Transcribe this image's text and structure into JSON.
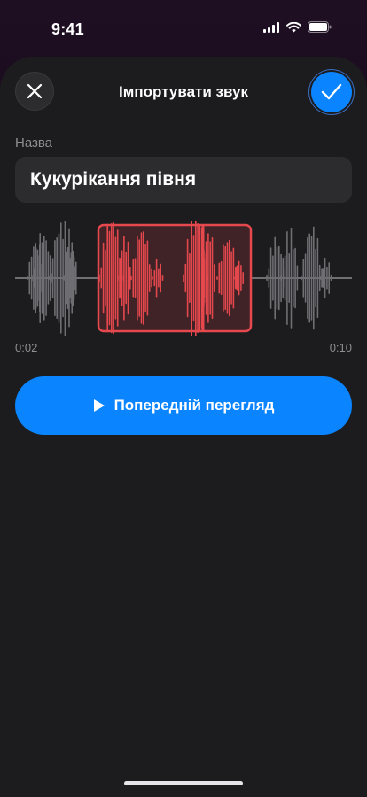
{
  "status_bar": {
    "time": "9:41",
    "icons": [
      "cellular-signal-icon",
      "wifi-icon",
      "battery-icon"
    ]
  },
  "sheet": {
    "title": "Імпортувати звук",
    "close_icon": "close-icon",
    "confirm_icon": "checkmark-icon"
  },
  "name_field": {
    "label": "Назва",
    "value": "Кукурікання півня"
  },
  "trimmer": {
    "start_time": "0:02",
    "end_time": "0:10",
    "selection_start_fraction": 0.23,
    "selection_end_fraction": 0.66,
    "playhead_fraction": 0.47
  },
  "preview_button": {
    "icon": "play-icon",
    "label": "Попередній перегляд"
  },
  "colors": {
    "accent": "#0a84ff",
    "selection": "#e5484d",
    "waveform_inactive": "#6e6e73",
    "sheet_background": "#1c1c1e"
  }
}
